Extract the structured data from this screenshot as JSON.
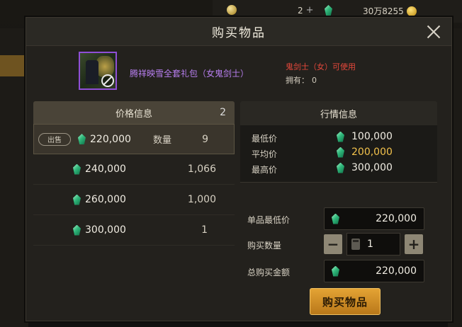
{
  "topbar": {
    "coin_count": "2",
    "gem_count": "30万8255",
    "plus": "+"
  },
  "dialog": {
    "title": "购买物品",
    "item": {
      "name": "腾祥映雪全套礼包（女鬼剑士）",
      "class_requirement": "鬼剑士（女）可使用",
      "owned_label": "拥有：",
      "owned_value": "0"
    },
    "price_panel": {
      "header": "价格信息",
      "count": "2",
      "sell_badge": "出售",
      "qty_label": "数量",
      "offers": [
        {
          "price": "220,000",
          "qty": "9"
        },
        {
          "price": "240,000",
          "qty": "1,066"
        },
        {
          "price": "260,000",
          "qty": "1,000"
        },
        {
          "price": "300,000",
          "qty": "1"
        }
      ]
    },
    "market_panel": {
      "header": "行情信息",
      "rows": [
        {
          "label": "最低价",
          "value": "100,000"
        },
        {
          "label": "平均价",
          "value": "200,000"
        },
        {
          "label": "最高价",
          "value": "300,000"
        }
      ]
    },
    "purchase": {
      "unit_min_label": "单品最低价",
      "unit_min_value": "220,000",
      "qty_label": "购买数量",
      "qty_value": "1",
      "minus": "−",
      "plus": "+",
      "total_label": "总购买金额",
      "total_value": "220,000",
      "buy_button": "购买物品"
    }
  },
  "colors": {
    "accent": "#e4a334",
    "item_name": "#b87ff0",
    "class_req": "#e5483b",
    "avg_price": "#f3c24c"
  }
}
